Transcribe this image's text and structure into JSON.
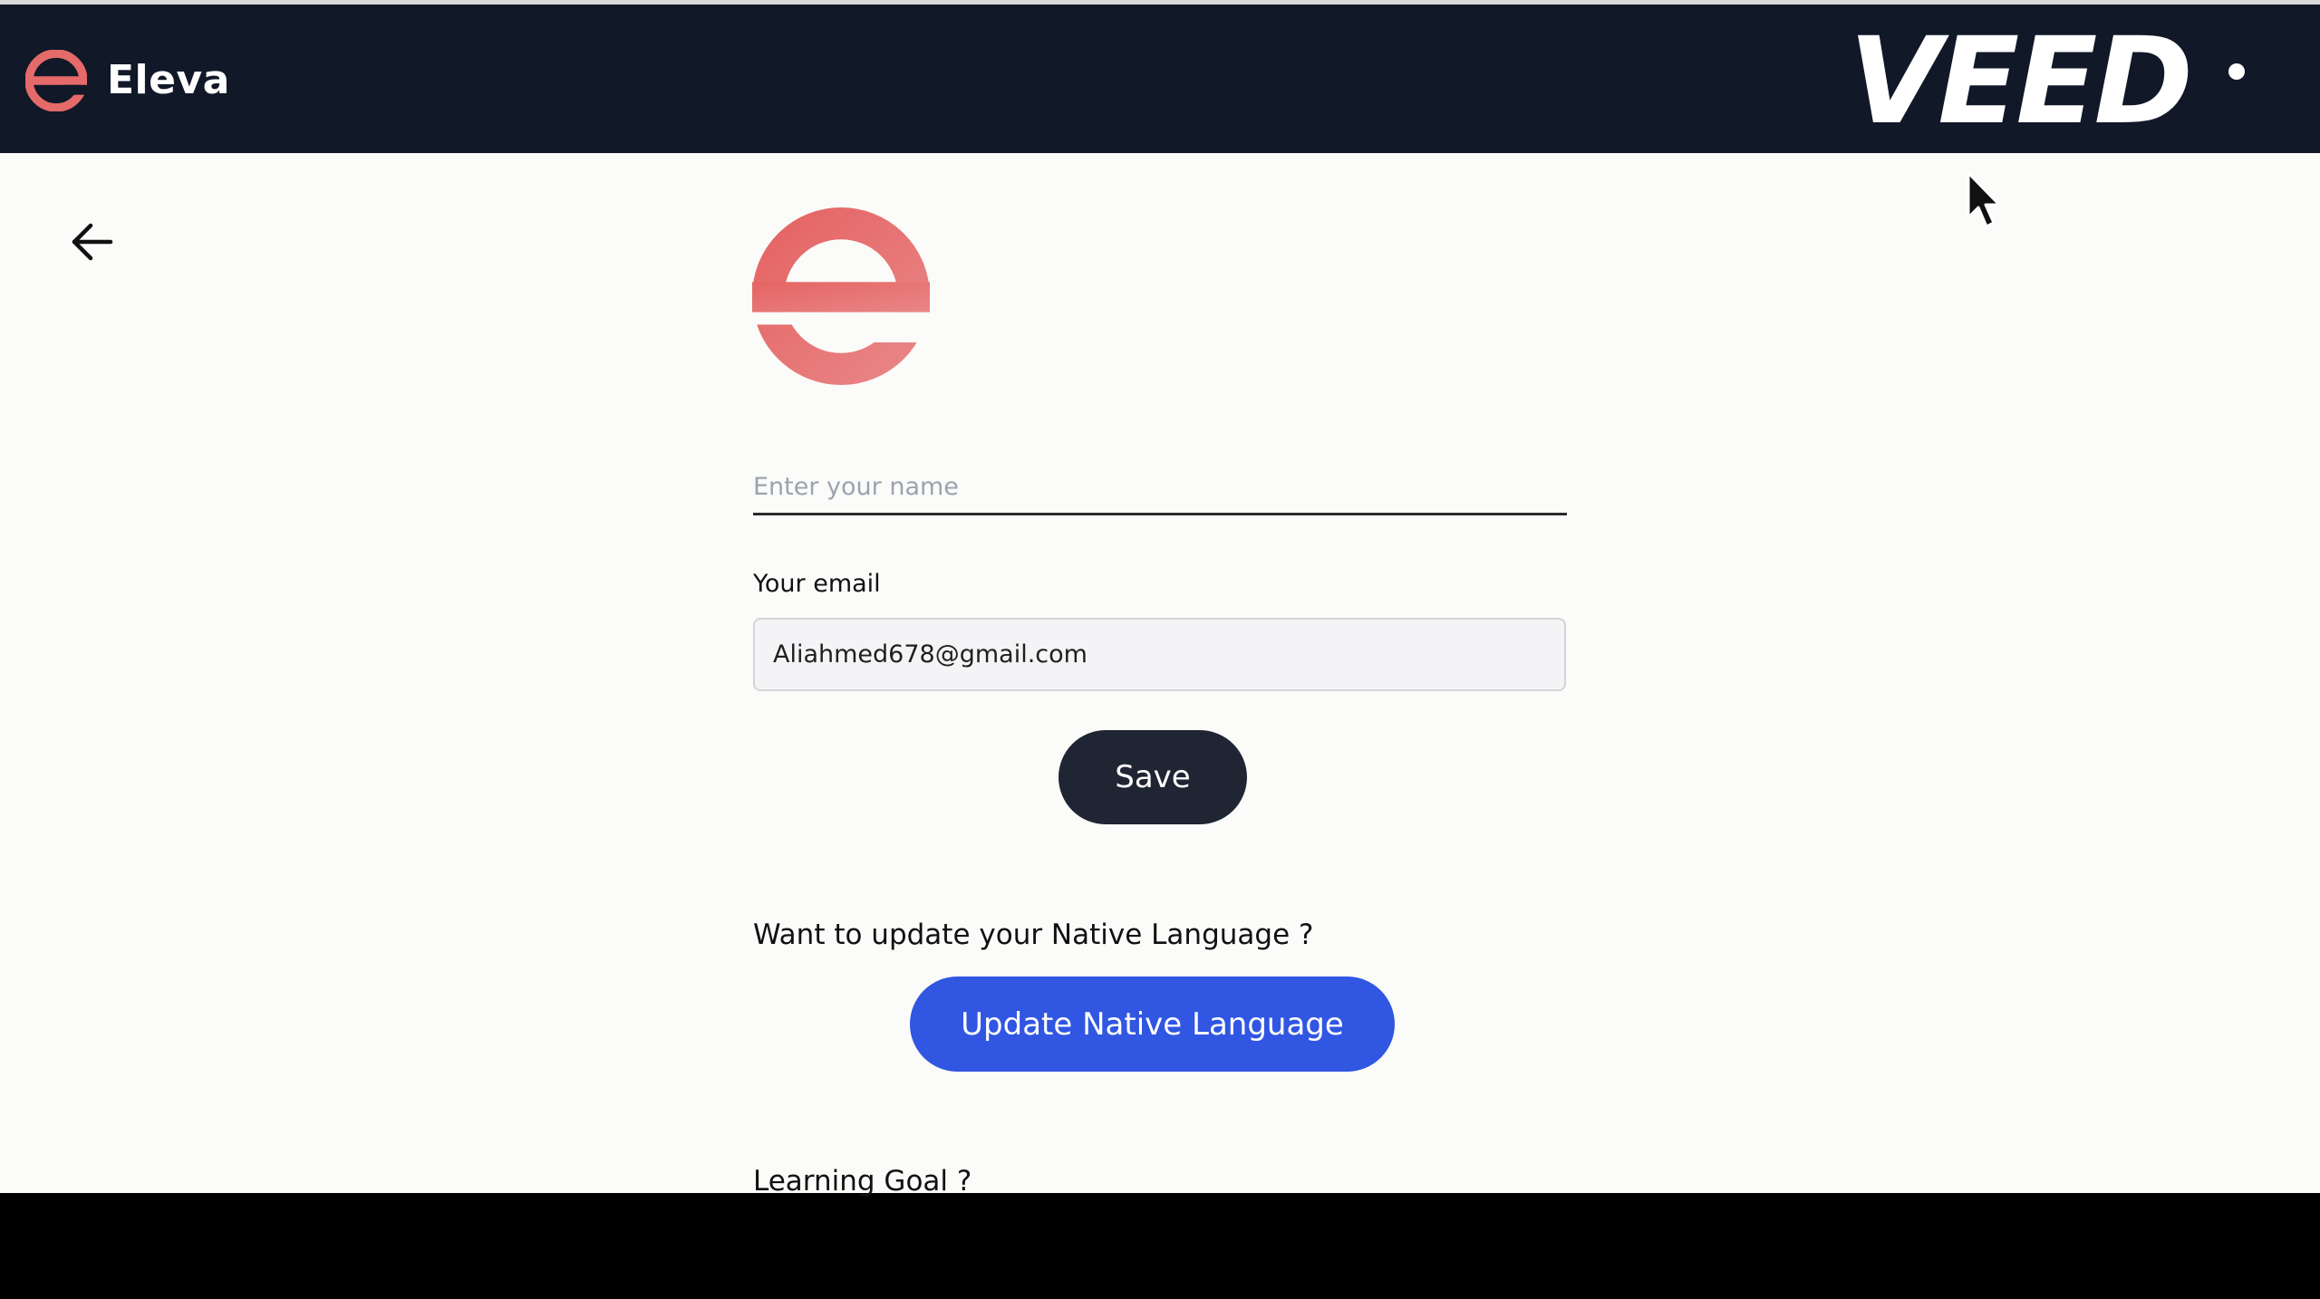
{
  "app": {
    "name": "Eleva"
  },
  "watermark": {
    "text": "VEED"
  },
  "icons": {
    "app_logo": "eleva-e-logo-icon",
    "back": "arrow-left-icon",
    "cursor": "mouse-pointer-icon"
  },
  "colors": {
    "navbar_bg": "#111827",
    "brand_red": "#e56a6a",
    "save_bg": "#1f2533",
    "primary_blue": "#3056e2",
    "page_bg": "#fbfbf9"
  },
  "profile_form": {
    "name_placeholder": "Enter your name",
    "name_value": "",
    "email_label": "Your email",
    "email_value": "Aliahmed678@gmail.com",
    "save_label": "Save"
  },
  "native_language": {
    "question": "Want to update your Native Language ?",
    "button_label": "Update Native Language"
  },
  "learning_goal": {
    "label": "Learning Goal ?"
  }
}
